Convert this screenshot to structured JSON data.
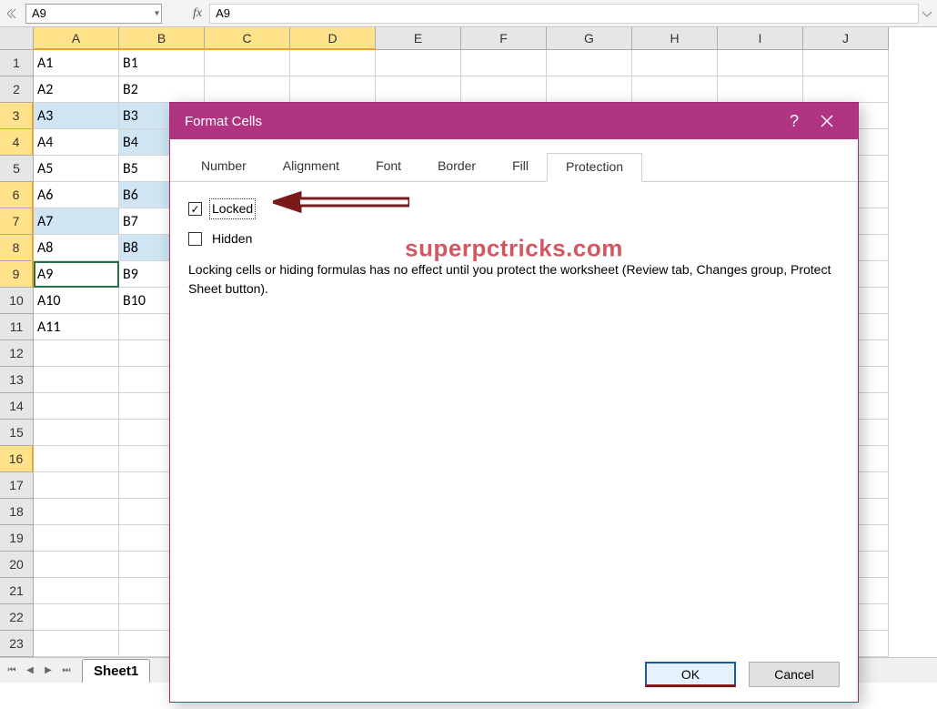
{
  "formula_bar": {
    "name_box_value": "A9",
    "fx_label": "fx",
    "formula_value": "A9"
  },
  "columns": [
    "A",
    "B",
    "C",
    "D",
    "E",
    "F",
    "G",
    "H",
    "I",
    "J"
  ],
  "rows_visible": 24,
  "active_cell": "A9",
  "selected_col_headers": [
    "A",
    "B",
    "C",
    "D"
  ],
  "selected_row_headers": [
    3,
    4,
    6,
    7,
    8,
    9,
    16
  ],
  "highlighted_cells": [
    "A3",
    "B3",
    "B4",
    "B6",
    "A7",
    "B8"
  ],
  "cell_data": {
    "A1": "A1",
    "A2": "A2",
    "A3": "A3",
    "A4": "A4",
    "A5": "A5",
    "A6": "A6",
    "A7": "A7",
    "A8": "A8",
    "A9": "A9",
    "A10": "A10",
    "A11": "A11",
    "B1": "B1",
    "B2": "B2",
    "B3": "B3",
    "B4": "B4",
    "B5": "B5",
    "B6": "B6",
    "B7": "B7",
    "B8": "B8",
    "B9": "B9",
    "B10": "B10"
  },
  "sheet_tabs": {
    "active": "Sheet1"
  },
  "dialog": {
    "title": "Format Cells",
    "tabs": [
      "Number",
      "Alignment",
      "Font",
      "Border",
      "Fill",
      "Protection"
    ],
    "active_tab": "Protection",
    "locked_label": "Locked",
    "locked_checked": true,
    "hidden_label": "Hidden",
    "hidden_checked": false,
    "description": "Locking cells or hiding formulas has no effect until you protect the worksheet (Review tab, Changes group, Protect Sheet button).",
    "ok_label": "OK",
    "cancel_label": "Cancel",
    "help_glyph": "?",
    "watermark": "superpctricks.com"
  }
}
